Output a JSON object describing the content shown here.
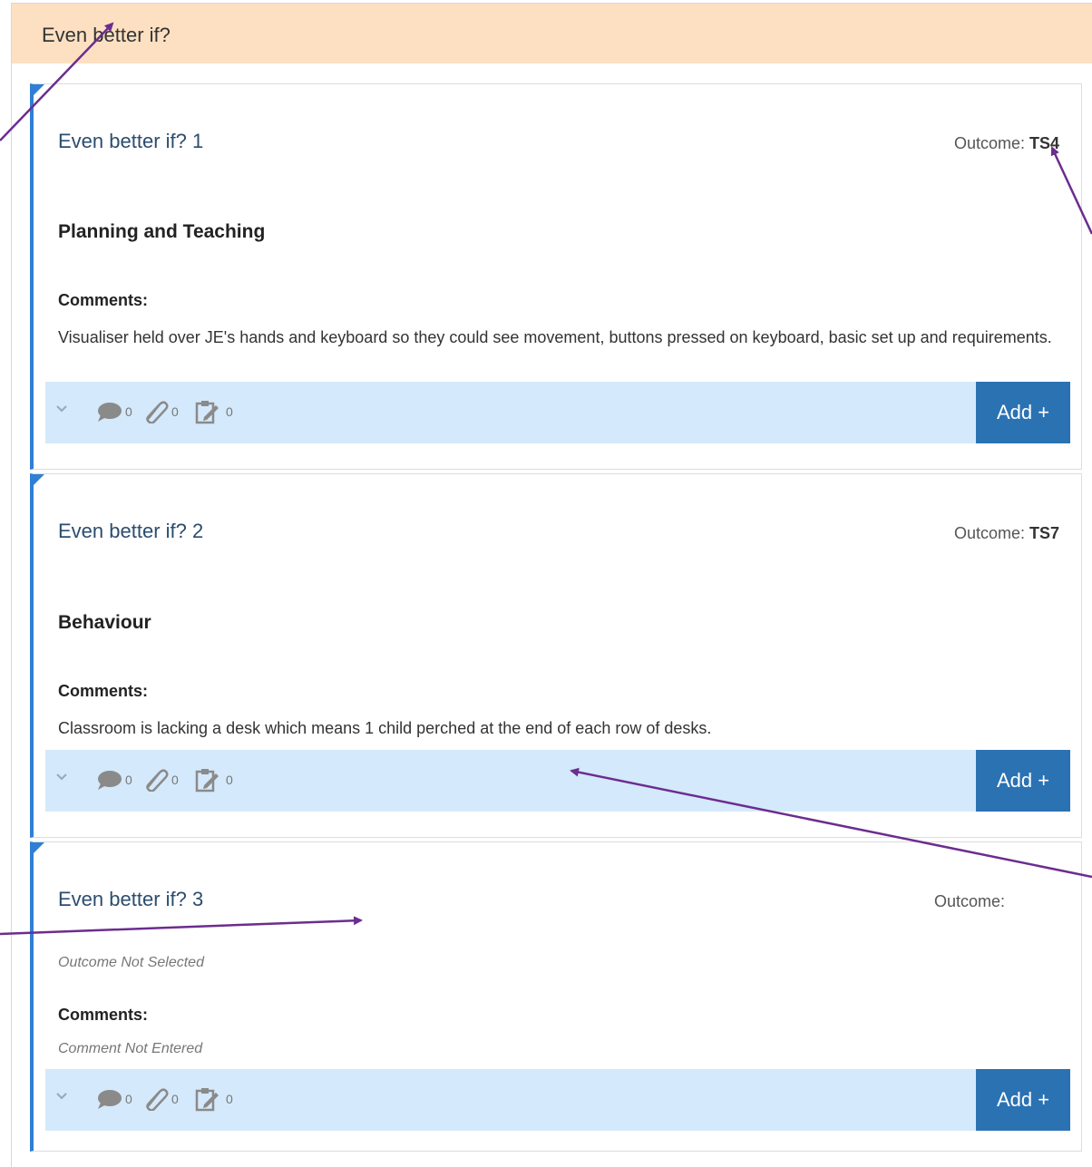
{
  "section": {
    "title": "Even better if?"
  },
  "cards": [
    {
      "title": "Even better if? 1",
      "outcome_label": "Outcome:",
      "outcome_value": "TS4",
      "category": "Planning and Teaching",
      "comments_label": "Comments:",
      "comment": "Visualiser held over JE's hands and keyboard so they could see movement, buttons pressed on keyboard, basic set up and requirements.",
      "counts": {
        "comments": "0",
        "attachments": "0",
        "notes": "0"
      },
      "add_label": "Add +"
    },
    {
      "title": "Even better if? 2",
      "outcome_label": "Outcome:",
      "outcome_value": "TS7",
      "category": "Behaviour",
      "comments_label": "Comments:",
      "comment": "Classroom is lacking a desk which means 1 child perched at the end of each row of desks.",
      "counts": {
        "comments": "0",
        "attachments": "0",
        "notes": "0"
      },
      "add_label": "Add +"
    },
    {
      "title": "Even better if? 3",
      "outcome_label": "Outcome:",
      "outcome_value": "",
      "category_placeholder": "Outcome Not Selected",
      "comments_label": "Comments:",
      "comment_placeholder": "Comment Not Entered",
      "counts": {
        "comments": "0",
        "attachments": "0",
        "notes": "0"
      },
      "add_label": "Add +"
    }
  ],
  "colors": {
    "header_bg": "#fde0c2",
    "card_accent": "#2f7fd6",
    "toolbar_bg": "#d4e9fb",
    "add_button": "#2b72b3",
    "annotation_arrow": "#6b2d8f"
  }
}
